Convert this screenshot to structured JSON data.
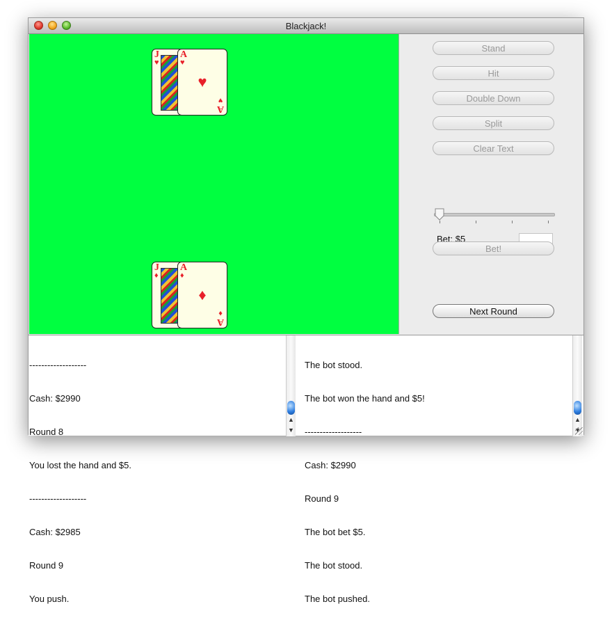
{
  "window": {
    "title": "Blackjack!"
  },
  "dealer_hand": [
    {
      "rank": "J",
      "suit_symbol": "♥",
      "suit": "hearts",
      "art": "jack-of-hearts-face"
    },
    {
      "rank": "A",
      "suit_symbol": "♥",
      "suit": "hearts"
    }
  ],
  "player_hand": [
    {
      "rank": "J",
      "suit_symbol": "♦",
      "suit": "diamonds",
      "art": "jack-of-diamonds-face"
    },
    {
      "rank": "A",
      "suit_symbol": "♦",
      "suit": "diamonds"
    }
  ],
  "controls": {
    "stand_label": "Stand",
    "hit_label": "Hit",
    "double_down_label": "Double Down",
    "split_label": "Split",
    "clear_text_label": "Clear Text",
    "bet_label": "Bet: $5",
    "bet_input_value": "",
    "bet_button_label": "Bet!",
    "next_round_label": "Next Round",
    "bet_slider_fraction": 0.0
  },
  "player_log": {
    "lines": [
      "-------------------",
      "Cash: $2990",
      "Round 8",
      "You lost the hand and $5.",
      "-------------------",
      "Cash: $2985",
      "Round 9",
      "You push."
    ]
  },
  "bot_log": {
    "lines": [
      "The bot stood.",
      "The bot won the hand and $5!",
      "-------------------",
      "Cash: $2990",
      "Round 9",
      "The bot bet $5.",
      "The bot stood.",
      "The bot pushed."
    ]
  },
  "colors": {
    "table_felt": "#00ff40",
    "card_red": "#e8202a",
    "card_face": "#fefee6"
  }
}
